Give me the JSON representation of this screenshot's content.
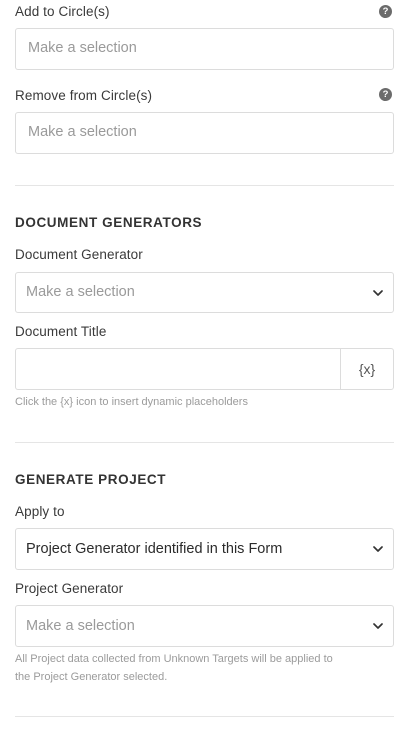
{
  "circles": {
    "add_label": "Add to Circle(s)",
    "add_placeholder": "Make a selection",
    "remove_label": "Remove from Circle(s)",
    "remove_placeholder": "Make a selection",
    "help_glyph": "?"
  },
  "document_generators": {
    "title": "DOCUMENT GENERATORS",
    "generator_label": "Document Generator",
    "generator_placeholder": "Make a selection",
    "doc_title_label": "Document Title",
    "doc_title_value": "",
    "placeholder_button": "{x}",
    "hint": "Click the {x} icon to insert dynamic placeholders"
  },
  "generate_project": {
    "title": "GENERATE PROJECT",
    "apply_to_label": "Apply to",
    "apply_to_value": "Project Generator identified in this Form",
    "project_generator_label": "Project Generator",
    "project_generator_placeholder": "Make a selection",
    "hint_line1": "All Project data collected from Unknown Targets will be applied to",
    "hint_line2": "the Project Generator selected."
  },
  "icons": {
    "help": "help-circle-icon",
    "chevron": "chevron-down-icon",
    "variable": "variable-placeholder-icon"
  }
}
